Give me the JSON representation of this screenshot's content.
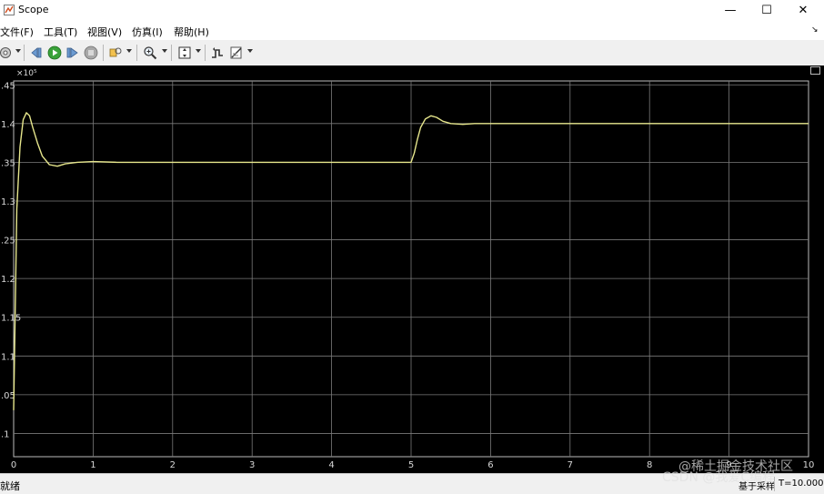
{
  "window": {
    "title": "Scope"
  },
  "controls": {
    "minimize": "—",
    "maximize": "☐",
    "close": "✕"
  },
  "menu": [
    {
      "label": "文件(F)"
    },
    {
      "label": "工具(T)"
    },
    {
      "label": "视图(V)"
    },
    {
      "label": "仿真(I)"
    },
    {
      "label": "帮助(H)"
    }
  ],
  "toolbar": {
    "icons": [
      "settings-icon",
      "step-back-icon",
      "run-icon",
      "step-forward-icon",
      "stop-icon",
      "highlight-icon",
      "zoom-icon",
      "autoscale-icon",
      "triggers-icon",
      "measurements-icon"
    ]
  },
  "chart_data": {
    "type": "line",
    "title": "",
    "xlabel": "",
    "ylabel": "",
    "exponent_label": "×10⁵",
    "xlim": [
      0,
      10
    ],
    "ylim": [
      0.97,
      1.455
    ],
    "x_ticks": [
      "0",
      "1",
      "2",
      "3",
      "4",
      "5",
      "6",
      "7",
      "8",
      "9",
      "10"
    ],
    "y_ticks": [
      "1",
      "1.05",
      "1.1",
      "1.15",
      "1.2",
      "1.25",
      "1.3",
      "1.35",
      "1.4",
      "1.45"
    ],
    "y_tick_labels": [
      ".1",
      ".05",
      "1.1",
      "1.15",
      "1.2",
      ".25",
      "1.3",
      ".35",
      "1.4",
      ".45"
    ],
    "grid": true,
    "background": "#000000",
    "grid_color": "#7a7a7a",
    "line_color": "#e6e68c",
    "series": [
      {
        "x": [
          0,
          0.04,
          0.08,
          0.12,
          0.16,
          0.2,
          0.24,
          0.3,
          0.36,
          0.45,
          0.55,
          0.65,
          0.8,
          1.0,
          1.3,
          2,
          3,
          4,
          4.98,
          5.0,
          5.04,
          5.08,
          5.12,
          5.18,
          5.25,
          5.32,
          5.4,
          5.5,
          5.65,
          5.8,
          6,
          7,
          8,
          9,
          10
        ],
        "y": [
          1.03,
          1.29,
          1.37,
          1.405,
          1.414,
          1.41,
          1.395,
          1.375,
          1.358,
          1.347,
          1.345,
          1.348,
          1.35,
          1.351,
          1.35,
          1.35,
          1.35,
          1.35,
          1.35,
          1.35,
          1.362,
          1.38,
          1.395,
          1.406,
          1.41,
          1.408,
          1.403,
          1.4,
          1.399,
          1.4,
          1.4,
          1.4,
          1.4,
          1.4,
          1.4
        ]
      }
    ]
  },
  "status": {
    "left": "就绪",
    "mode": "基于采样",
    "time": "T=10.000"
  },
  "watermark": {
    "top": "@稀土掘金技术社区",
    "bottom": "CSDN @我爱C编程"
  }
}
